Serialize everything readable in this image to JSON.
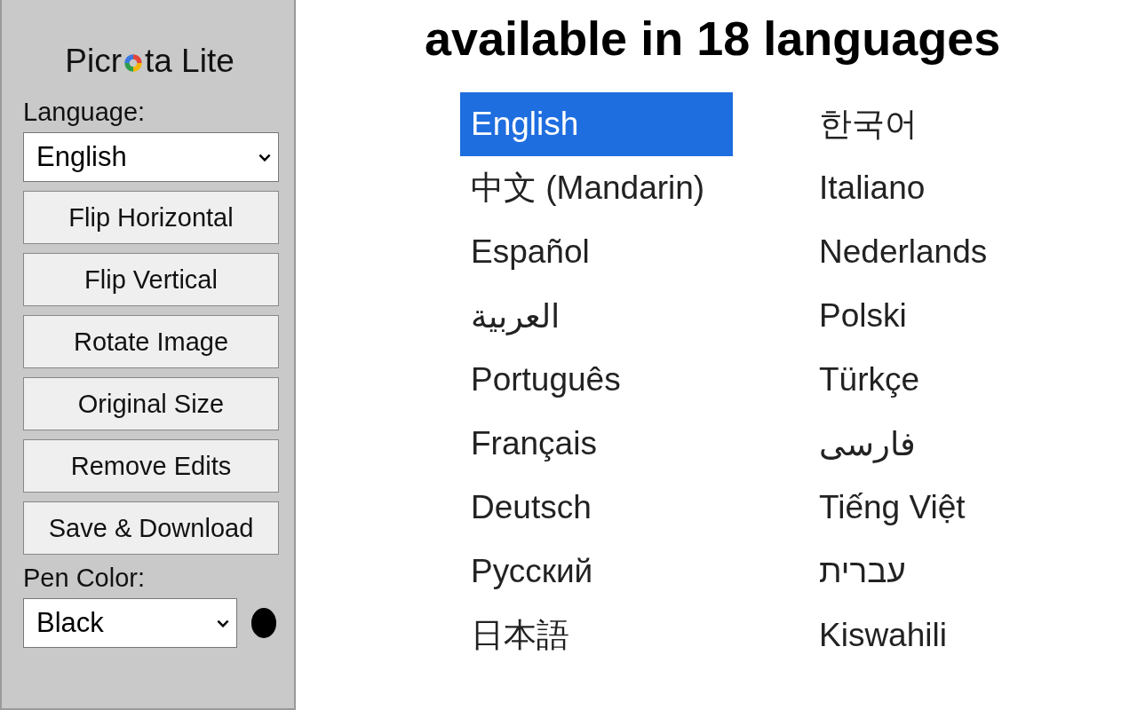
{
  "panel": {
    "title_start": "Picr",
    "title_end": "ta Lite",
    "language_label": "Language:",
    "language_select": "English",
    "buttons": [
      "Flip Horizontal",
      "Flip Vertical",
      "Rotate Image",
      "Original Size",
      "Remove Edits",
      "Save & Download"
    ],
    "pen_color_label": "Pen Color:",
    "pen_color_select": "Black",
    "pen_dot": {
      "color": "#000000"
    }
  },
  "heading": "available in 18 languages",
  "languages": [
    {
      "label": "English",
      "selected": true
    },
    {
      "label": "中文 (Mandarin)",
      "selected": false
    },
    {
      "label": "Español",
      "selected": false
    },
    {
      "label": "العربية",
      "selected": false
    },
    {
      "label": "Português",
      "selected": false
    },
    {
      "label": "Français",
      "selected": false
    },
    {
      "label": "Deutsch",
      "selected": false
    },
    {
      "label": "Русский",
      "selected": false
    },
    {
      "label": "日本語",
      "selected": false
    },
    {
      "label": "한국어",
      "selected": false
    },
    {
      "label": "Italiano",
      "selected": false
    },
    {
      "label": "Nederlands",
      "selected": false
    },
    {
      "label": "Polski",
      "selected": false
    },
    {
      "label": "Türkçe",
      "selected": false
    },
    {
      "label": "فارسی",
      "selected": false
    },
    {
      "label": "Tiếng Việt",
      "selected": false
    },
    {
      "label": "עברית",
      "selected": false
    },
    {
      "label": "Kiswahili",
      "selected": false
    }
  ]
}
